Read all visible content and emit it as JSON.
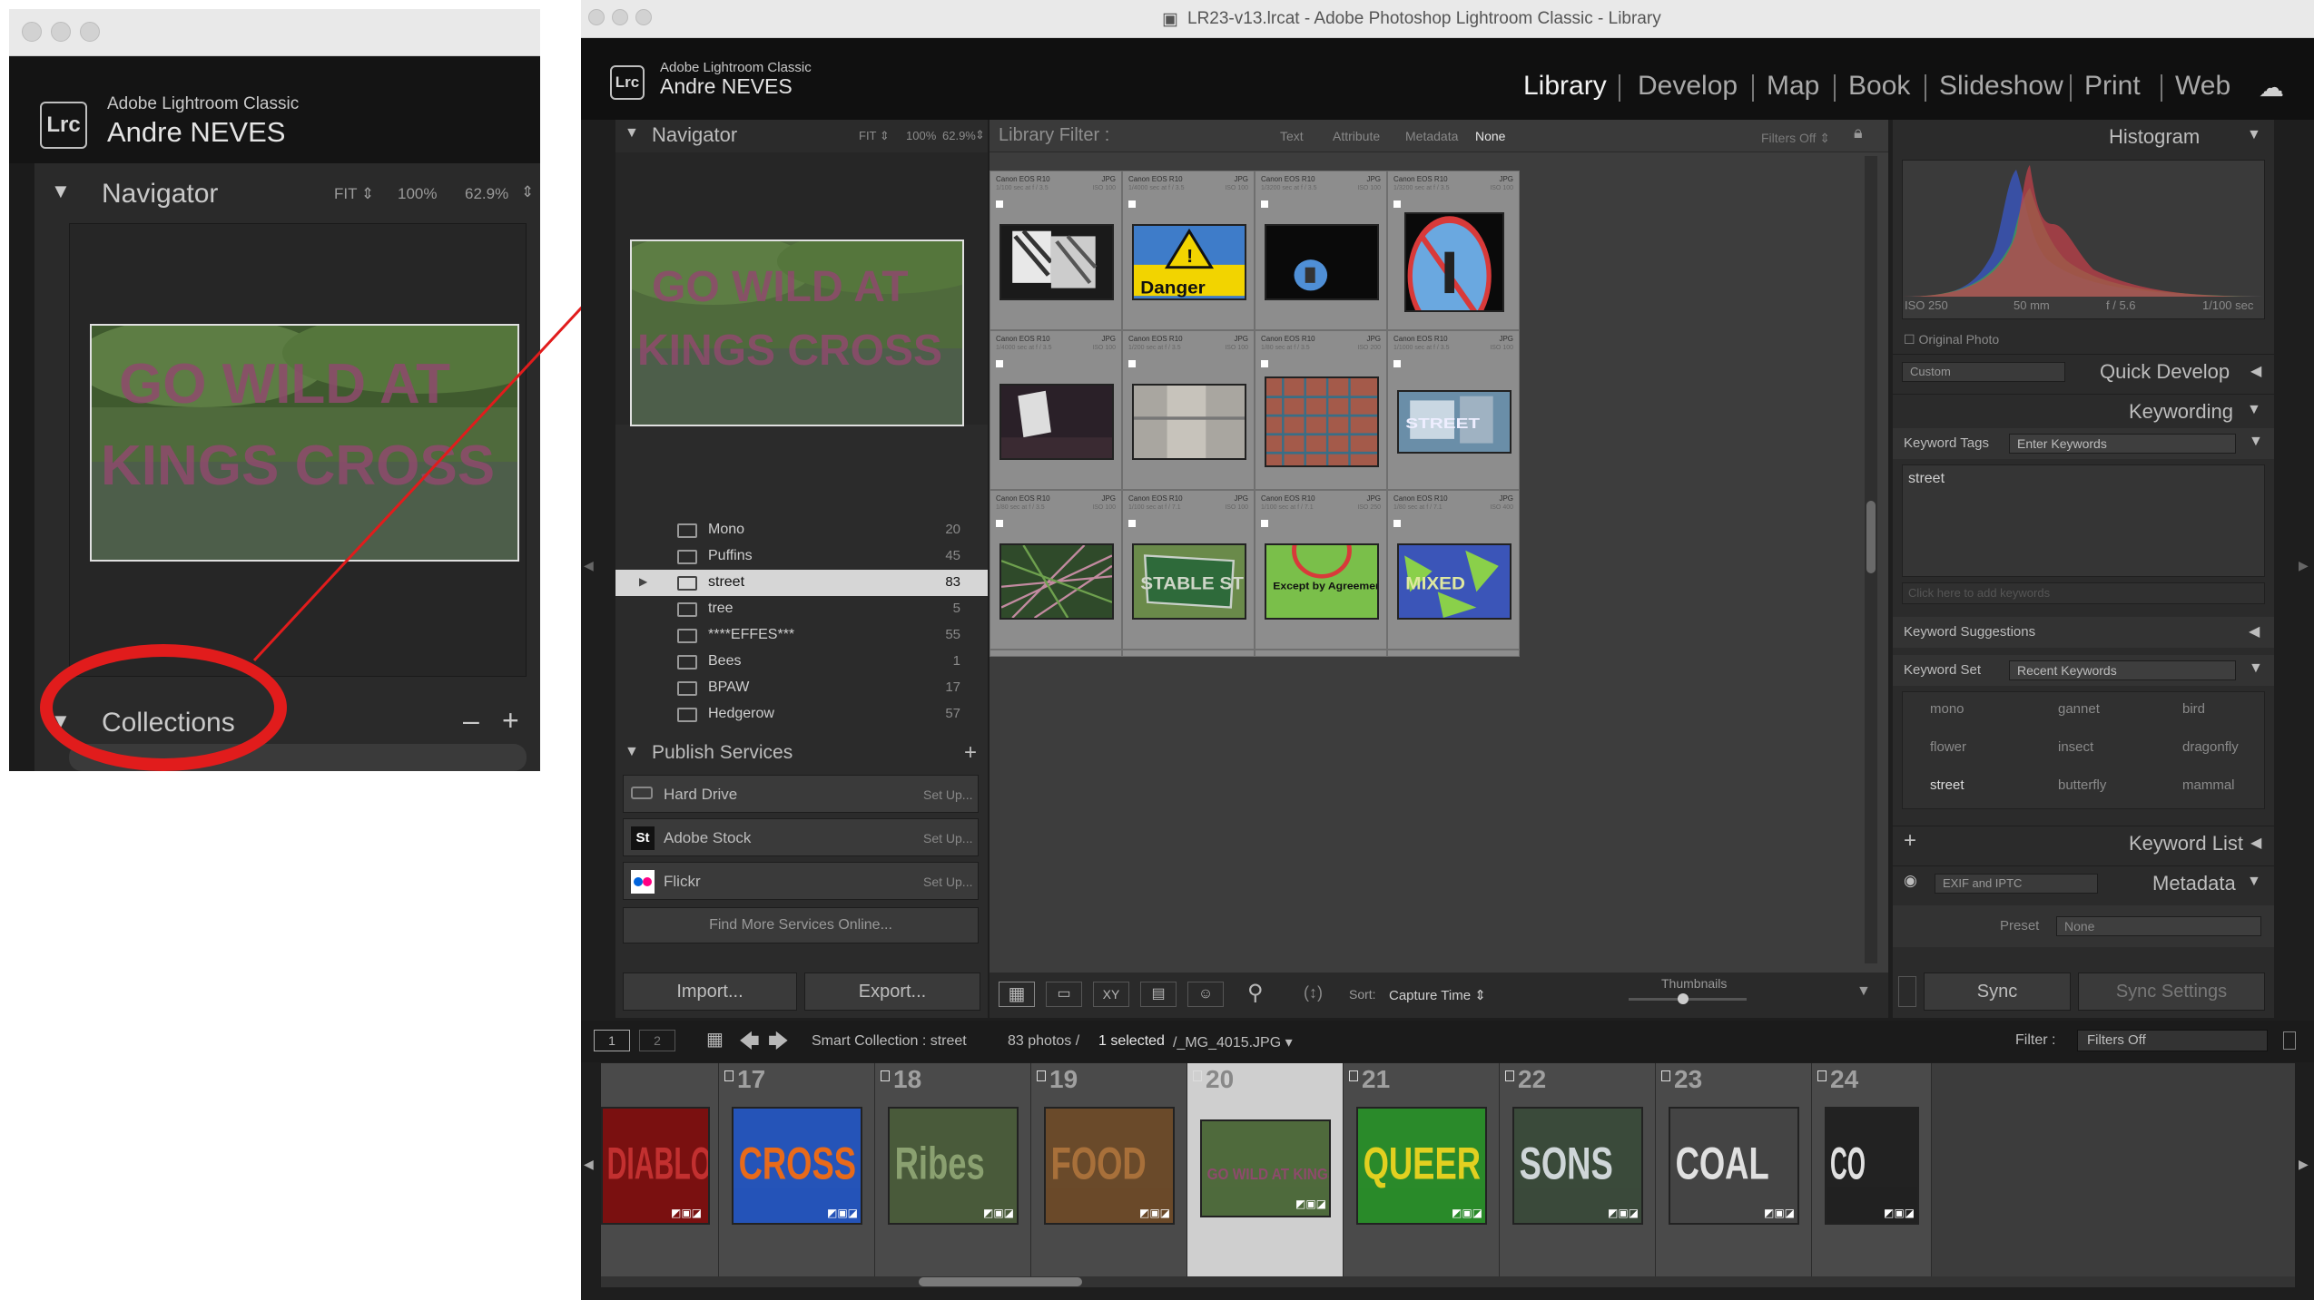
{
  "inset": {
    "app_name": "Adobe Lightroom Classic",
    "user": "Andre NEVES",
    "badge": "Lrc",
    "navigator": {
      "title": "Navigator",
      "fit": "FIT",
      "zoom1": "100%",
      "zoom2": "62.9%"
    },
    "collections": {
      "title": "Collections",
      "minus": "–",
      "plus": "+"
    }
  },
  "window": {
    "title": "LR23-v13.lrcat - Adobe Photoshop Lightroom Classic - Library",
    "app_name": "Adobe Lightroom Classic",
    "user": "Andre NEVES",
    "badge": "Lrc",
    "modules": [
      "Library",
      "Develop",
      "Map",
      "Book",
      "Slideshow",
      "Print",
      "Web"
    ]
  },
  "left_panel": {
    "navigator": {
      "title": "Navigator",
      "fit": "FIT",
      "zoom1": "100%",
      "zoom2": "62.9%"
    },
    "collections": [
      {
        "name": "Mono",
        "count": "20"
      },
      {
        "name": "Puffins",
        "count": "45"
      },
      {
        "name": "street",
        "count": "83"
      },
      {
        "name": "tree",
        "count": "5"
      },
      {
        "name": "****EFFES***",
        "count": "55"
      },
      {
        "name": "Bees",
        "count": "1"
      },
      {
        "name": "BPAW",
        "count": "17"
      },
      {
        "name": "Hedgerow",
        "count": "57"
      }
    ],
    "publish_services": {
      "title": "Publish Services",
      "items": [
        {
          "name": "Hard Drive",
          "action": "Set Up..."
        },
        {
          "name": "Adobe Stock",
          "action": "Set Up..."
        },
        {
          "name": "Flickr",
          "action": "Set Up..."
        }
      ],
      "find_more": "Find More Services Online..."
    },
    "import": "Import...",
    "export": "Export..."
  },
  "library_filter": {
    "label": "Library Filter :",
    "tabs": [
      "Text",
      "Attribute",
      "Metadata",
      "None"
    ],
    "filters_off": "Filters Off"
  },
  "grid": [
    {
      "camera": "Canon EOS R10",
      "format": "JPG",
      "exposure": "1/100 sec at f / 3.5",
      "iso": "ISO 100"
    },
    {
      "camera": "Canon EOS R10",
      "format": "JPG",
      "exposure": "1/4000 sec at f / 3.5",
      "iso": "ISO 100"
    },
    {
      "camera": "Canon EOS R10",
      "format": "JPG",
      "exposure": "1/3200 sec at f / 3.5",
      "iso": "ISO 100"
    },
    {
      "camera": "Canon EOS R10",
      "format": "JPG",
      "exposure": "1/3200 sec at f / 3.5",
      "iso": "ISO 100"
    },
    {
      "camera": "Canon EOS R10",
      "format": "JPG",
      "exposure": "1/4000 sec at f / 3.5",
      "iso": "ISO 100"
    },
    {
      "camera": "Canon EOS R10",
      "format": "JPG",
      "exposure": "1/200 sec at f / 3.5",
      "iso": "ISO 100"
    },
    {
      "camera": "Canon EOS R10",
      "format": "JPG",
      "exposure": "1/80 sec at f / 3.5",
      "iso": "ISO 200"
    },
    {
      "camera": "Canon EOS R10",
      "format": "JPG",
      "exposure": "1/1000 sec at f / 3.5",
      "iso": "ISO 100"
    },
    {
      "camera": "Canon EOS R10",
      "format": "JPG",
      "exposure": "1/80 sec at f / 3.5",
      "iso": "ISO 100"
    },
    {
      "camera": "Canon EOS R10",
      "format": "JPG",
      "exposure": "1/100 sec at f / 7.1",
      "iso": "ISO 100"
    },
    {
      "camera": "Canon EOS R10",
      "format": "JPG",
      "exposure": "1/100 sec at f / 7.1",
      "iso": "ISO 250"
    },
    {
      "camera": "Canon EOS R10",
      "format": "JPG",
      "exposure": "1/80 sec at f / 7.1",
      "iso": "ISO 400"
    }
  ],
  "toolbar": {
    "sort_label": "Sort:",
    "sort_value": "Capture Time",
    "thumbnails_label": "Thumbnails"
  },
  "right_panel": {
    "histogram": {
      "title": "Histogram",
      "iso": "ISO 250",
      "focal": "50 mm",
      "aperture": "f / 5.6",
      "shutter": "1/100 sec",
      "original_photo": "Original Photo"
    },
    "quick_develop": {
      "title": "Quick Develop",
      "preset": "Custom"
    },
    "keywording": {
      "title": "Keywording",
      "tags_label": "Keyword Tags",
      "tags_value": "Enter Keywords",
      "keywords": "street",
      "add_placeholder": "Click here to add keywords",
      "suggestions": "Keyword Suggestions",
      "set_label": "Keyword Set",
      "set_value": "Recent Keywords",
      "set_keywords": [
        "mono",
        "gannet",
        "bird",
        "flower",
        "insect",
        "dragonfly",
        "street",
        "butterfly",
        "mammal"
      ]
    },
    "keyword_list": {
      "title": "Keyword List",
      "plus": "+"
    },
    "metadata": {
      "title": "Metadata",
      "preset_label": "Preset",
      "preset_value": "None",
      "view": "EXIF and IPTC"
    },
    "sync": "Sync",
    "sync_settings": "Sync Settings"
  },
  "filmstrip_bar": {
    "page1": "1",
    "page2": "2",
    "source": "Smart Collection : street",
    "count": "83 photos /",
    "selected": "1 selected",
    "file": "/_MG_4015.JPG",
    "filter_label": "Filter :",
    "filter_value": "Filters Off"
  },
  "filmstrip": [
    {
      "num": "",
      "text": "DIABLO"
    },
    {
      "num": "17",
      "text": "CROSS"
    },
    {
      "num": "18",
      "text": "Ribes"
    },
    {
      "num": "19",
      "text": "FOOD"
    },
    {
      "num": "20",
      "text": "GO WILD AT KINGS CROSS"
    },
    {
      "num": "21",
      "text": "QUEER"
    },
    {
      "num": "22",
      "text": "SONS"
    },
    {
      "num": "23",
      "text": "COAL"
    },
    {
      "num": "24",
      "text": "CO"
    }
  ],
  "photo_text": {
    "danger": "Danger",
    "stable": "STABLE STREET",
    "except": "Except by Agreement with KCES",
    "mixed": "MIXED",
    "street_sign": "STREET",
    "go_wild": "GO WILD AT",
    "kings_cross": "KINGS CROSS"
  },
  "colors": {
    "accent_red": "#e11c1c",
    "panel": "#2b2b2b",
    "grid_cell": "#8d8d8d"
  }
}
